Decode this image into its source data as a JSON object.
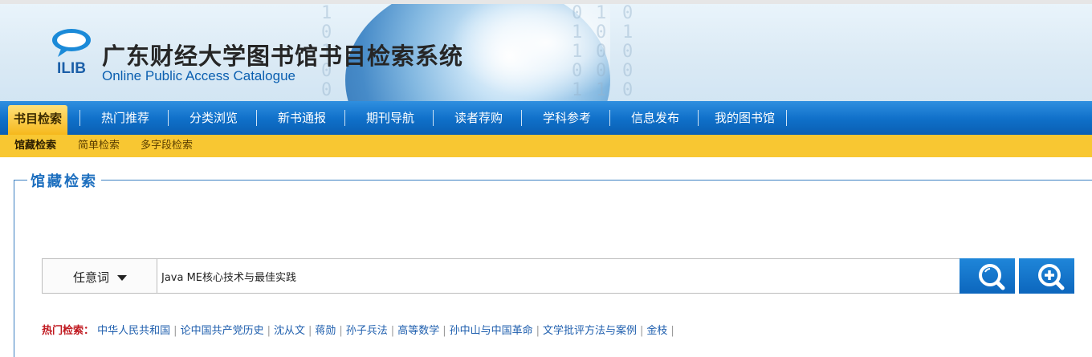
{
  "header": {
    "logo_text": "ILIB",
    "title_cn": "广东财经大学图书馆书目检索系统",
    "title_en": "Online Public Access Catalogue",
    "icon": "ilib-logo-icon"
  },
  "nav": {
    "items": [
      {
        "label": "书目检索",
        "active": true
      },
      {
        "label": "热门推荐"
      },
      {
        "label": "分类浏览"
      },
      {
        "label": "新书通报"
      },
      {
        "label": "期刊导航"
      },
      {
        "label": "读者荐购"
      },
      {
        "label": "学科参考"
      },
      {
        "label": "信息发布"
      },
      {
        "label": "我的图书馆"
      }
    ]
  },
  "subnav": {
    "items": [
      {
        "label": "馆藏检索",
        "active": true
      },
      {
        "label": "简单检索"
      },
      {
        "label": "多字段检索"
      }
    ]
  },
  "section": {
    "title": "馆藏检索"
  },
  "search": {
    "type_value": "任意词",
    "query": "Java ME核心技术与最佳实践",
    "search_icon": "magnifier-icon",
    "advanced_icon": "magnifier-plus-icon"
  },
  "hot": {
    "label": "热门检索：",
    "items": [
      "中华人民共和国",
      "论中国共产党历史",
      "沈从文",
      "蒋勋",
      "孙子兵法",
      "高等数学",
      "孙中山与中国革命",
      "文学批评方法与案例",
      "金枝"
    ]
  },
  "colors": {
    "nav_blue": "#0f6fc8",
    "subnav_yellow": "#f8c732",
    "link_blue": "#1f5fae",
    "hot_red": "#c0181f"
  }
}
